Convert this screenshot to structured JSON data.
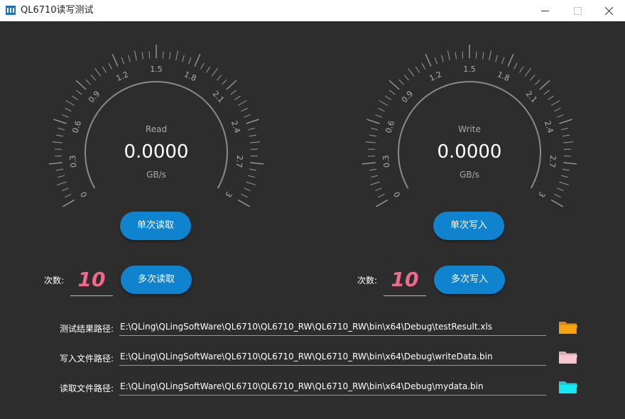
{
  "window": {
    "title": "QL6710读写测试",
    "icon": "app-chip-icon"
  },
  "read_gauge": {
    "label": "Read",
    "value": "0.0000",
    "unit": "GB/s",
    "min": 0,
    "max": 3,
    "ticks": [
      "0",
      "0.3",
      "0.6",
      "0.9",
      "1.2",
      "1.5",
      "1.8",
      "2.1",
      "2.4",
      "2.7",
      "3"
    ]
  },
  "write_gauge": {
    "label": "Write",
    "value": "0.0000",
    "unit": "GB/s",
    "min": 0,
    "max": 3,
    "ticks": [
      "0",
      "0.3",
      "0.6",
      "0.9",
      "1.2",
      "1.5",
      "1.8",
      "2.1",
      "2.4",
      "2.7",
      "3"
    ]
  },
  "buttons": {
    "single_read": "单次读取",
    "single_write": "单次写入",
    "multi_read": "多次读取",
    "multi_write": "多次写入"
  },
  "read_count": {
    "label": "次数:",
    "value": "10"
  },
  "write_count": {
    "label": "次数:",
    "value": "10"
  },
  "paths": [
    {
      "label": "测试结果路径:",
      "value": "E:\\QLing\\QLingSoftWare\\QL6710\\QL6710_RW\\QL6710_RW\\bin\\x64\\Debug\\testResult.xls",
      "folder_icon": "folder-orange-icon",
      "folder_color": "#f5a30f"
    },
    {
      "label": "写入文件路径:",
      "value": "E:\\QLing\\QLingSoftWare\\QL6710\\QL6710_RW\\QL6710_RW\\bin\\x64\\Debug\\writeData.bin",
      "folder_icon": "folder-pink-icon",
      "folder_color": "#f7c6d0"
    },
    {
      "label": "读取文件路径:",
      "value": "E:\\QLing\\QLingSoftWare\\QL6710\\QL6710_RW\\QL6710_RW\\bin\\x64\\Debug\\mydata.bin",
      "folder_icon": "folder-cyan-icon",
      "folder_color": "#19e6f0"
    }
  ],
  "colors": {
    "background": "#2d2d2d",
    "button": "#1083cf",
    "count_text": "#f06a8e",
    "gauge_arc": "#8a8a8a",
    "tick_text": "#b0b0b0"
  }
}
